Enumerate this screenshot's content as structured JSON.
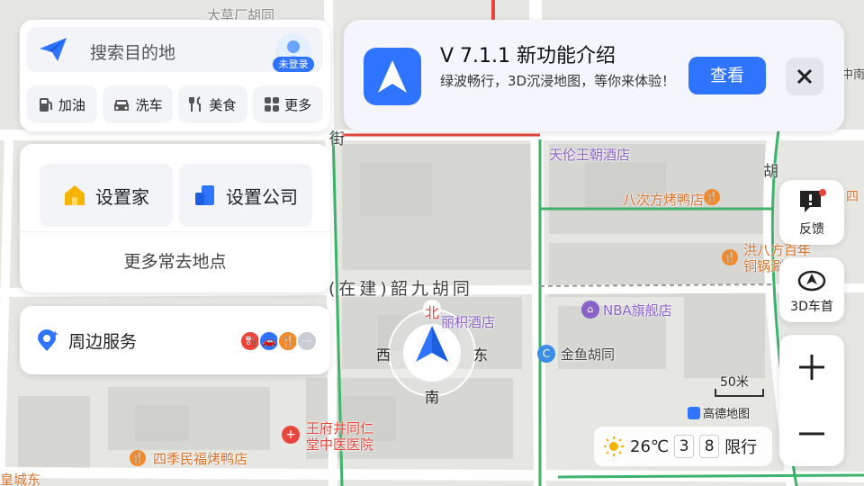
{
  "search": {
    "placeholder": "搜索目的地",
    "login_badge": "未登录"
  },
  "quick_actions": [
    {
      "label": "加油",
      "icon": "fuel-icon"
    },
    {
      "label": "洗车",
      "icon": "car-wash-icon"
    },
    {
      "label": "美食",
      "icon": "food-icon"
    },
    {
      "label": "更多",
      "icon": "grid-icon"
    }
  ],
  "places": {
    "home": "设置家",
    "company": "设置公司",
    "more": "更多常去地点"
  },
  "services": {
    "title": "周边服务",
    "more": "···"
  },
  "promo": {
    "title": "V 7.1.1 新功能介绍",
    "description": "绿波畅行，3D沉浸地图，等你来体验！",
    "view_button": "查看"
  },
  "side_controls": {
    "feedback": "反馈",
    "heading_3d": "3D车首"
  },
  "weather": {
    "temperature": "26℃",
    "plate_1": "3",
    "plate_2": "8",
    "restriction": "限行"
  },
  "scale": {
    "label": "50米",
    "brand": "高德地图"
  },
  "compass": {
    "north": "北",
    "south": "南",
    "east": "东",
    "west": "西"
  },
  "map_labels": {
    "tianlun": "天伦王朝酒店",
    "bacifang": "八次方烤鸭店",
    "hongbafang_1": "洪八方百年",
    "hongbafang_2": "铜锅涮肉",
    "shaojiu": "(在建)韶九胡同",
    "liji": "丽枳酒店",
    "nba": "NBA旗舰店",
    "jinyu": "金鱼胡同",
    "wangfujing_1": "王府井同仁",
    "wangfujing_2": "堂中医医院",
    "siji": "四季民福烤鸭店",
    "huangcheng": "皇城东",
    "jie": "街",
    "hu": "胡",
    "si": "四",
    "zhongnan": "中南",
    "top_road": "大草厂胡同"
  },
  "colors": {
    "accent": "#2f74ff",
    "road_green": "#3db36b",
    "poi_orange": "#f08a2a",
    "poi_red": "#e8463c"
  }
}
